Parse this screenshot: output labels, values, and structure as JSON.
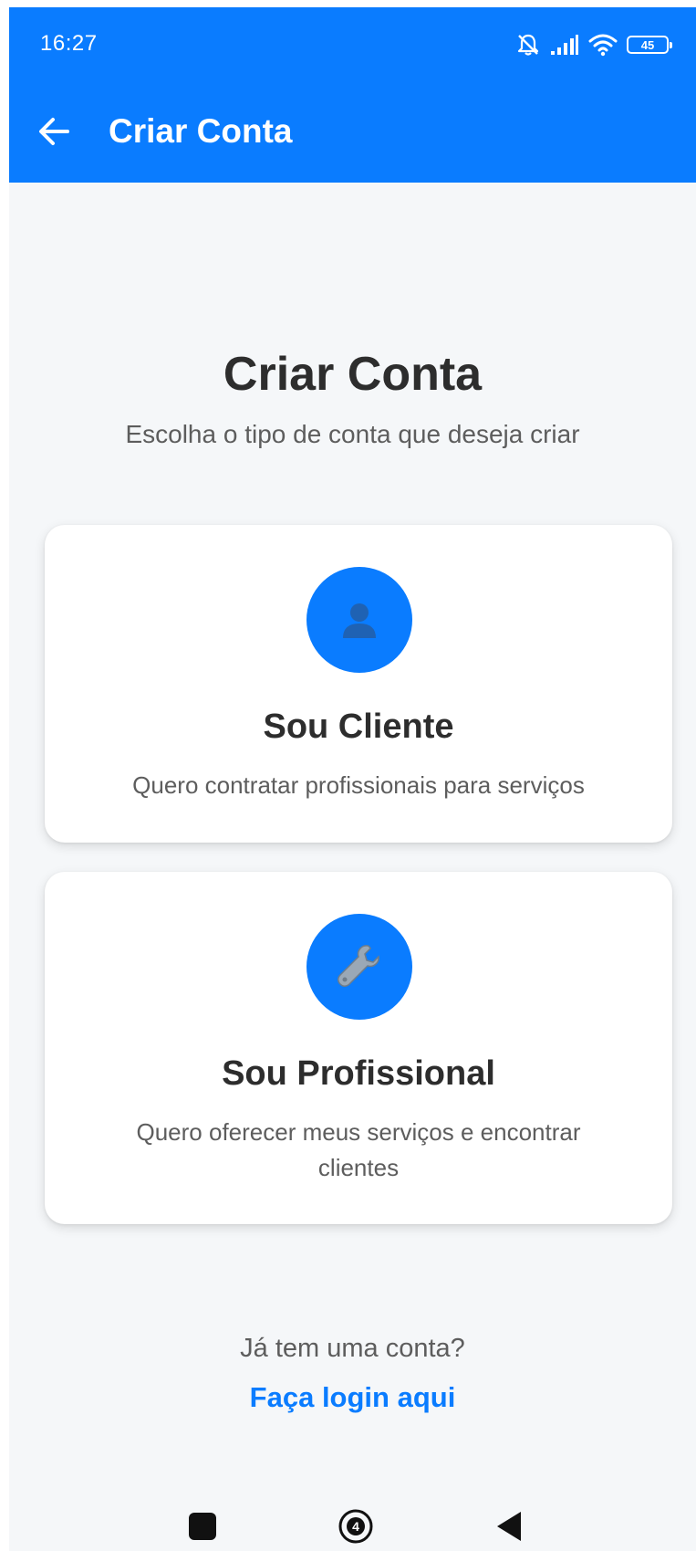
{
  "status_bar": {
    "time": "16:27",
    "battery_level": "45",
    "icons": [
      "bell-off-icon",
      "signal-icon",
      "wifi-icon",
      "battery-icon"
    ]
  },
  "app_bar": {
    "title": "Criar Conta",
    "back_icon": "arrow-left-icon"
  },
  "main": {
    "title": "Criar Conta",
    "subtitle": "Escolha o tipo de conta que deseja criar"
  },
  "cards": [
    {
      "icon": "person-icon",
      "title": "Sou Cliente",
      "description": "Quero contratar profissionais para serviços"
    },
    {
      "icon": "wrench-icon",
      "title": "Sou Profissional",
      "description": "Quero oferecer meus serviços e encontrar clientes"
    }
  ],
  "login": {
    "question": "Já tem uma conta?",
    "link": "Faça login aqui"
  },
  "nav_bar": {
    "home_badge": "4",
    "buttons": [
      "recents-button",
      "home-button",
      "back-button"
    ]
  },
  "colors": {
    "primary": "#0a7cff",
    "background": "#f5f7f9",
    "text_dark": "#2d2d2d",
    "text_muted": "#5d5d5d"
  }
}
